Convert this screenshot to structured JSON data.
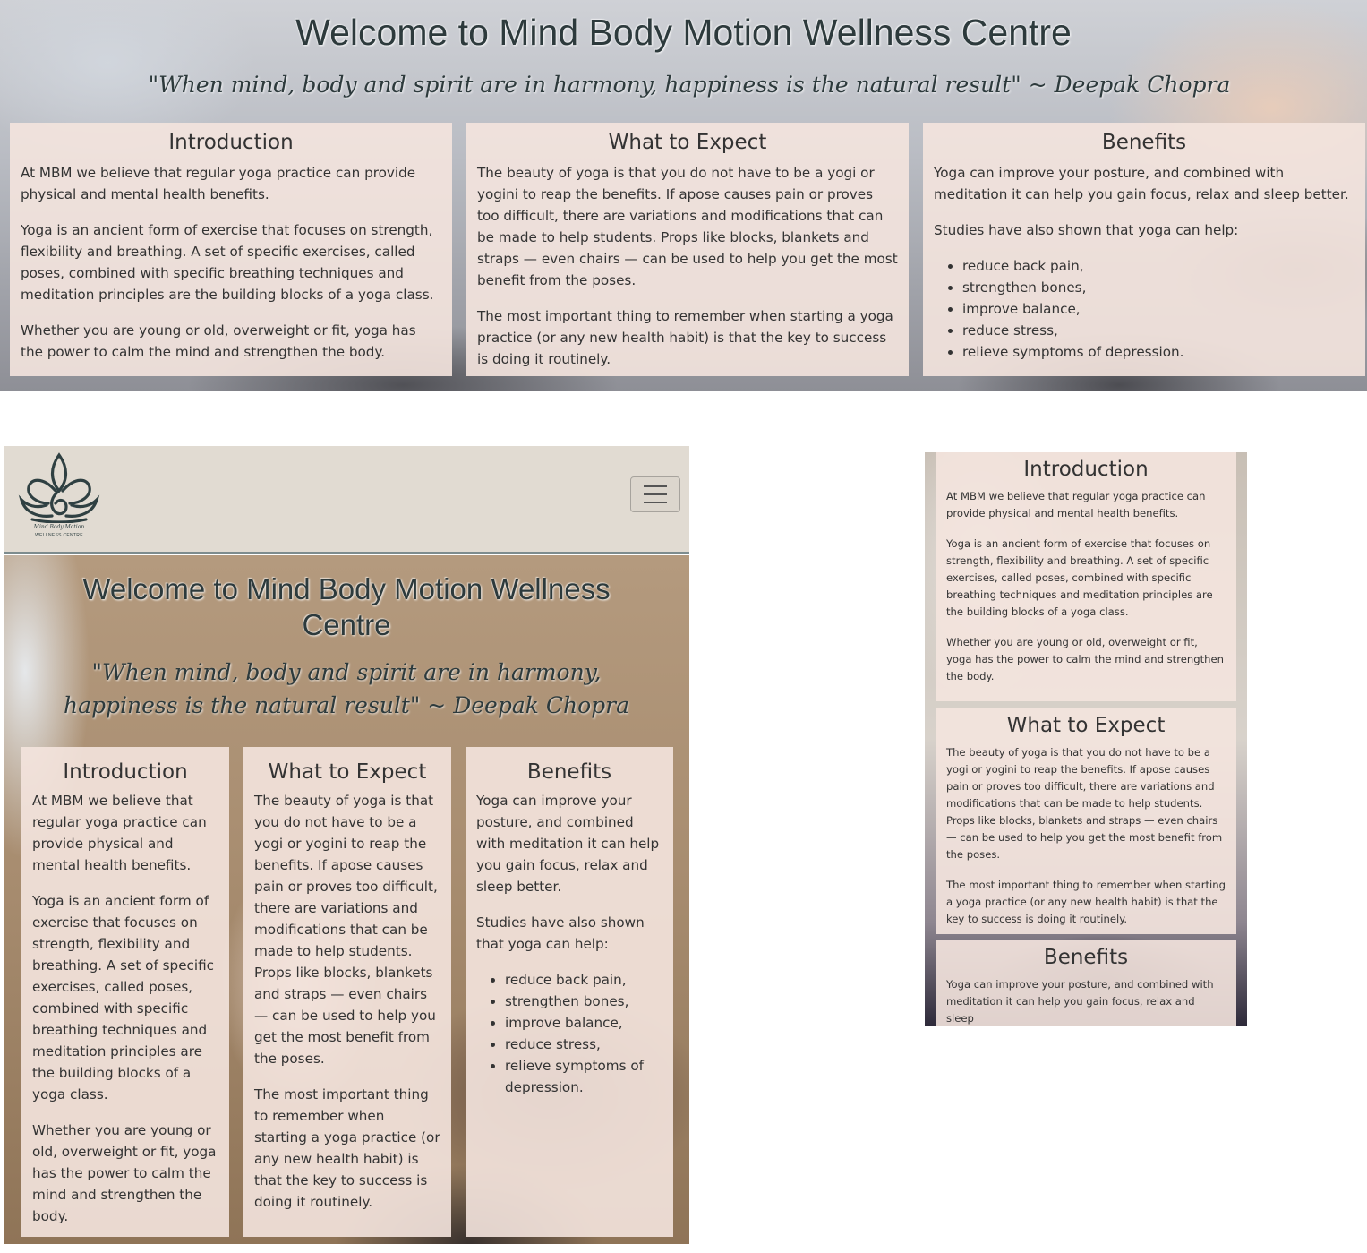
{
  "site": {
    "title": "Welcome to Mind Body Motion Wellness Centre",
    "quote": "\"When mind, body and spirit are in harmony, happiness is the natural result\" ~ Deepak Chopra",
    "logo_text": "Mind Body Motion",
    "logo_subtext": "WELLNESS CENTRE"
  },
  "intro": {
    "heading": "Introduction",
    "p1": "At MBM we believe that regular yoga practice can provide physical and mental health benefits.",
    "p2": "Yoga is an ancient form of exercise that focuses on strength, flexibility and breathing. A set of specific exercises, called poses, combined with specific breathing techniques and meditation principles are the building blocks of a yoga class.",
    "p3": "Whether you are young or old, overweight or fit, yoga has the power to calm the mind and strengthen the body."
  },
  "expect": {
    "heading": "What to Expect",
    "p1": "The beauty of yoga is that you do not have to be a yogi or yogini to reap the benefits. If apose causes pain or proves too difficult, there are variations and modifications that can be made to help students. Props like blocks, blankets and straps — even chairs — can be used to help you get the most benefit from the poses.",
    "p2": "The most important thing to remember when starting a yoga practice (or any new health habit) is that the key to success is doing it routinely."
  },
  "benefits": {
    "heading": "Benefits",
    "p1": "Yoga can improve your posture, and combined with meditation it can help you gain focus, relax and sleep better.",
    "p2": "Studies have also shown that yoga can help:",
    "items": [
      "reduce back pain,",
      "strengthen bones,",
      "improve balance,",
      "reduce stress,",
      "relieve symptoms of depression."
    ],
    "p1_partial": "Yoga can improve your posture, and combined with meditation it can help you gain focus, relax and sleep"
  },
  "icons": {
    "menu": "hamburger-icon",
    "logo": "lotus-logo-icon"
  },
  "colors": {
    "card_bg": "#f4e4de",
    "text": "#333333",
    "heading_dark": "#2d3a3c",
    "navbar_bg": "#e1dbd2"
  }
}
